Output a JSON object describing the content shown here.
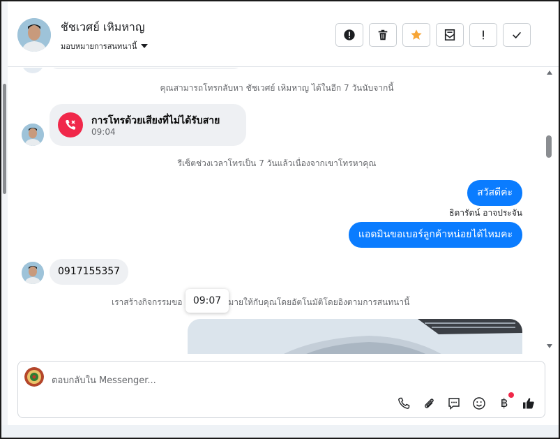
{
  "header": {
    "name": "ชัชเวศย์ เหิมหาญ",
    "assign_label": "มอบหมายการสนทนานี้"
  },
  "toolbar": {
    "icons": [
      "report-icon",
      "trash-icon",
      "star-icon",
      "mark-unread-icon",
      "exclamation-icon",
      "check-icon"
    ],
    "star_color": "#f7a535"
  },
  "chat": {
    "notice_callback": "คุณสามารถโทรกลับหา ชัชเวศย์ เหิมหาญ ได้ในอีก 7 วันนับจากนี้",
    "missed_call": {
      "title": "การโทรด้วยเสียงที่ไม่ได้รับสาย",
      "time": "09:04"
    },
    "notice_reset": "รีเซ็ตช่วงเวลาโทรเป็น 7 วันแล้วเนื่องจากเขาโทรหาคุณ",
    "outgoing_1": "สวัสดีค่ะ",
    "sender_name": "ธิดารัตน์ อาจประจัน",
    "outgoing_2": "แอดมินขอเบอร์ลูกค้าหน่อยได้ไหมคะ",
    "incoming_phone": "0917155357",
    "notice_activity": "เราสร้างกิจกรรมขอ",
    "notice_activity_rest": "หมายให้กับคุณโดยอัตโนมัติโดยอิงตามการสนทนานี้",
    "tooltip_time": "09:07"
  },
  "reply": {
    "placeholder": "ตอบกลับใน Messenger...",
    "baht_symbol": "฿",
    "icons": [
      "phone-icon",
      "attachment-icon",
      "saved-reply-icon",
      "emoji-icon",
      "baht-icon",
      "like-icon"
    ]
  },
  "colors": {
    "accent": "#0a7cff",
    "missed_call": "#f0284a",
    "notification_dot": "#f02849"
  }
}
